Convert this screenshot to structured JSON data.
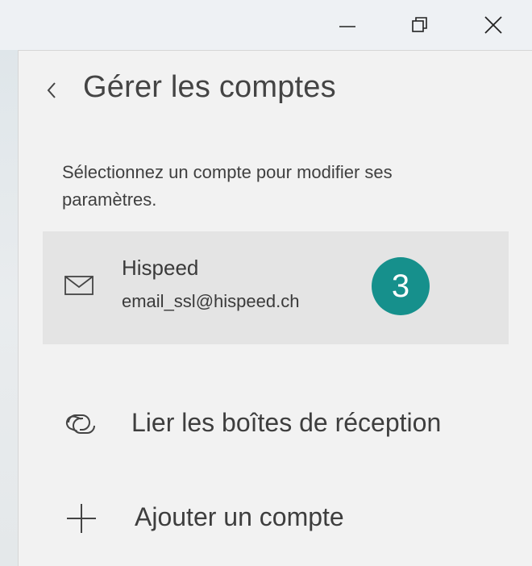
{
  "window": {
    "minimize_icon": "minimize-icon",
    "restore_icon": "restore-icon",
    "close_icon": "close-icon"
  },
  "panel": {
    "title": "Gérer les comptes",
    "back_icon": "chevron-left-icon",
    "instruction": "Sélectionnez un compte pour modifier ses paramètres."
  },
  "account": {
    "icon": "mail-envelope-icon",
    "name": "Hispeed",
    "email": "email_ssl@hispeed.ch",
    "badge": "3"
  },
  "actions": {
    "link_inboxes": {
      "icon": "link-icon",
      "label": "Lier les boîtes de réception"
    },
    "add_account": {
      "icon": "plus-icon",
      "label": "Ajouter un compte"
    }
  },
  "colors": {
    "badge": "#16908c",
    "panel_background": "#f2f2f2",
    "selected_item_background": "#e4e4e4"
  }
}
